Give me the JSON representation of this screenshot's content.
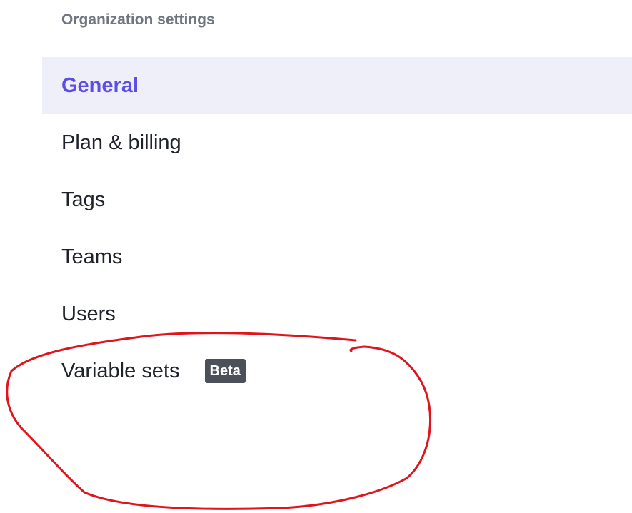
{
  "settings_nav": {
    "heading": "Organization settings",
    "items": [
      {
        "label": "General",
        "active": true
      },
      {
        "label": "Plan & billing",
        "active": false
      },
      {
        "label": "Tags",
        "active": false
      },
      {
        "label": "Teams",
        "active": false
      },
      {
        "label": "Users",
        "active": false
      },
      {
        "label": "Variable sets",
        "active": false,
        "badge": "Beta"
      }
    ]
  },
  "colors": {
    "active_text": "#5c4ee5",
    "active_background": "#eeeff9",
    "badge_background": "#4c5159",
    "annotation": "#e0141c"
  }
}
